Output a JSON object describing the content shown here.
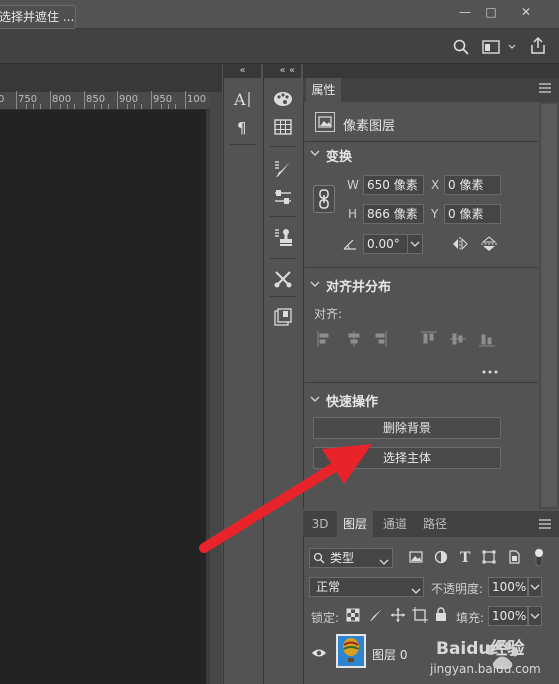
{
  "window": {
    "minimize": "—",
    "restore": "□",
    "close": "✕"
  },
  "options_bar": {
    "select_and_mask_label": "选择并遮住 ...",
    "search_icon": "search-icon",
    "workspace_icon": "workspace-icon",
    "share_icon": "share-icon"
  },
  "ruler": {
    "ticks": [
      "0",
      "750",
      "800",
      "850",
      "900",
      "950",
      "100"
    ]
  },
  "toolcol1": {
    "collapse": "«",
    "items": [
      "character-icon",
      "paragraph-icon"
    ]
  },
  "toolcol2": {
    "collapse": "«",
    "items": [
      "palette-icon",
      "grid-icon",
      "brush-settings-icon",
      "adjust-icon",
      "clone-stamp-icon",
      "tools-icon",
      "layer-comps-icon"
    ]
  },
  "properties": {
    "collapse": "«",
    "tab": "属性",
    "layer_type": "像素图层",
    "transform": {
      "title": "变换",
      "w_label": "W",
      "w_value": "650 像素",
      "x_label": "X",
      "x_value": "0 像素",
      "h_label": "H",
      "h_value": "866 像素",
      "y_label": "Y",
      "y_value": "0 像素",
      "angle_value": "0.00°"
    },
    "align": {
      "title": "对齐并分布",
      "align_label": "对齐:"
    },
    "quick": {
      "title": "快速操作",
      "remove_bg": "删除背景",
      "select_subject": "选择主体"
    }
  },
  "layers": {
    "tabs": [
      "3D",
      "图层",
      "通道",
      "路径"
    ],
    "active_tab": "图层",
    "filter_kind": "类型",
    "blend_mode": "正常",
    "opacity_label": "不透明度:",
    "opacity_value": "100%",
    "lock_label": "锁定:",
    "fill_label": "填充:",
    "fill_value": "100%",
    "layer_name": "图层 0"
  },
  "watermark": {
    "brand": "Baidu经验",
    "url": "jingyan.baidu.com"
  },
  "colors": {
    "panel": "#535353",
    "dark": "#383838",
    "canvas": "#232323",
    "arrow": "#e8232a"
  }
}
